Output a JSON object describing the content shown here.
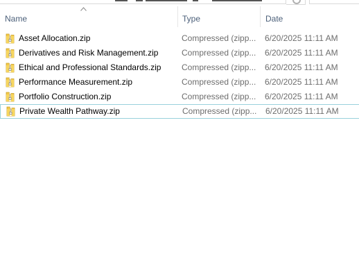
{
  "columns": {
    "name": "Name",
    "type": "Type",
    "date": "Date"
  },
  "sort": {
    "column": "name",
    "direction": "ascending"
  },
  "files": [
    {
      "name": "Asset Allocation.zip",
      "type": "Compressed (zipp...",
      "date": "6/20/2025 11:11 AM",
      "icon": "zip-folder-icon"
    },
    {
      "name": "Derivatives and Risk Management.zip",
      "type": "Compressed (zipp...",
      "date": "6/20/2025 11:11 AM",
      "icon": "zip-folder-icon"
    },
    {
      "name": "Ethical and Professional Standards.zip",
      "type": "Compressed (zipp...",
      "date": "6/20/2025 11:11 AM",
      "icon": "zip-folder-icon"
    },
    {
      "name": "Performance Measurement.zip",
      "type": "Compressed (zipp...",
      "date": "6/20/2025 11:11 AM",
      "icon": "zip-folder-icon"
    },
    {
      "name": "Portfolio Construction.zip",
      "type": "Compressed (zipp...",
      "date": "6/20/2025 11:11 AM",
      "icon": "zip-folder-icon"
    },
    {
      "name": "Private Wealth Pathway.zip",
      "type": "Compressed (zipp...",
      "date": "6/20/2025 11:11 AM",
      "icon": "zip-folder-icon",
      "focused": true
    }
  ],
  "colors": {
    "header_text": "#4c607a",
    "secondary_text": "#6d6d6d",
    "focus_border": "#99d1dc",
    "zip_folder": "#f3c94a"
  }
}
